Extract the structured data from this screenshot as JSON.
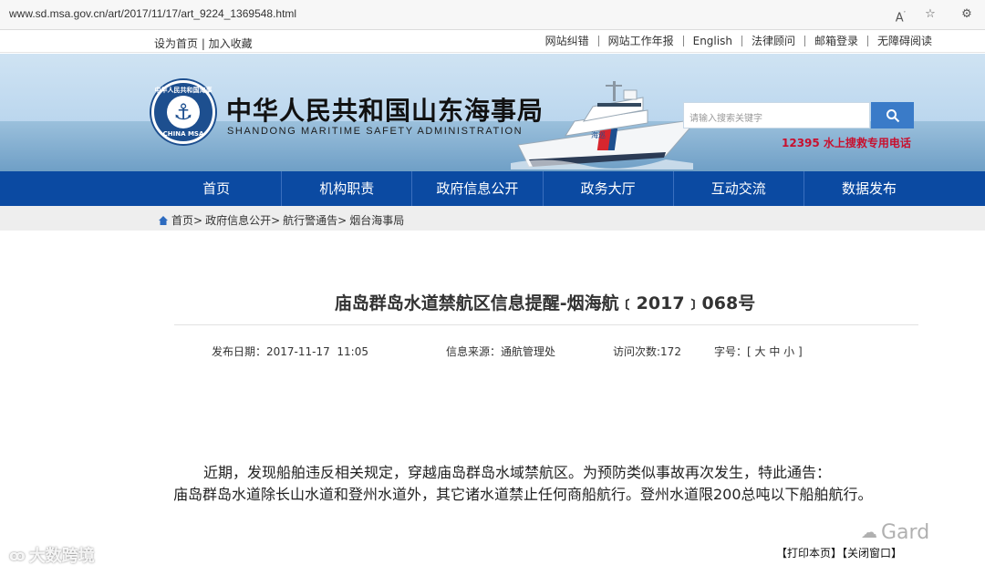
{
  "browser": {
    "url": "www.sd.msa.gov.cn/art/2017/11/17/art_9224_1369548.html",
    "icons": [
      "read-aloud-icon",
      "favorite-star-icon",
      "settings-icon"
    ]
  },
  "utility": {
    "left_links": "设为首页 | 加入收藏",
    "right_links": [
      "网站纠错",
      "网站工作年报",
      "English",
      "法律顾问",
      "邮箱登录",
      "无障碍阅读"
    ]
  },
  "banner": {
    "logo_text_top": "中华人民共和国海事局",
    "logo_text_bottom": "CHINA MSA",
    "title_cn": "中华人民共和国山东海事局",
    "title_en": "SHANDONG MARITIME SAFETY ADMINISTRATION",
    "ship_name": "海巡",
    "search_placeholder": "请输入搜索关键字",
    "hotline": "12395 水上搜救专用电话"
  },
  "nav": {
    "items": [
      "首页",
      "机构职责",
      "政府信息公开",
      "政务大厅",
      "互动交流",
      "数据发布"
    ]
  },
  "breadcrumb": {
    "items": [
      "首页>",
      "政府信息公开>",
      "航行警通告>",
      "烟台海事局"
    ]
  },
  "article": {
    "title": "庙岛群岛水道禁航区信息提醒-烟海航﹝2017﹞068号",
    "date_label": "发布日期：",
    "date_value": "2017-11-17  11:05",
    "source_label": "信息来源：",
    "source_value": "通航管理处",
    "visits_label": "访问次数:",
    "visits_value": "172",
    "fontsize_label": "字号：",
    "fontsize_value": "[ 大 中 小 ]",
    "paragraph_1": "近期，发现船舶违反相关规定，穿越庙岛群岛水域禁航区。为预防类似事故再次发生，特此通告：",
    "paragraph_2": "庙岛群岛水道除长山水道和登州水道外，其它诸水道禁止任何商船航行。登州水道限200总吨以下船舶航行。",
    "print_label": "【打印本页】",
    "close_label": "【关闭窗口】"
  },
  "watermarks": {
    "left": "大数跨境",
    "right": "Gard"
  },
  "colors": {
    "nav_blue": "#0b4aa2",
    "search_blue": "#3a7bc8",
    "hotline_red": "#c8102e"
  }
}
